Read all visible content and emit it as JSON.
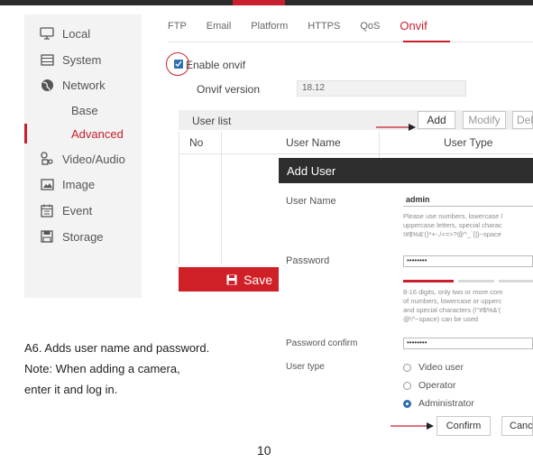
{
  "sidebar": {
    "items": [
      {
        "label": "Local",
        "icon": "monitor-icon"
      },
      {
        "label": "System",
        "icon": "window-icon"
      },
      {
        "label": "Network",
        "icon": "globe-icon"
      },
      {
        "label": "Base"
      },
      {
        "label": "Advanced",
        "active": true
      },
      {
        "label": "Video/Audio",
        "icon": "camera-icon"
      },
      {
        "label": "Image",
        "icon": "image-icon"
      },
      {
        "label": "Event",
        "icon": "calendar-icon"
      },
      {
        "label": "Storage",
        "icon": "floppy-disk-icon"
      }
    ]
  },
  "tabs": [
    "FTP",
    "Email",
    "Platform",
    "HTTPS",
    "QoS",
    "Onvif"
  ],
  "active_tab": "Onvif",
  "onvif": {
    "enable_label": "Enable onvif",
    "enabled": true,
    "version_label": "Onvif version",
    "version_value": "18.12"
  },
  "user_list": {
    "title": "User list",
    "buttons": {
      "add": "Add",
      "modify": "Modify",
      "delete": "Del"
    },
    "columns": [
      "No",
      "User Name",
      "User Type"
    ]
  },
  "save_label": "Save",
  "dialog": {
    "title": "Add User",
    "username_label": "User Name",
    "username_value": "admin",
    "username_hint": [
      "Please use numbers, lowercase l",
      "uppercase letters, special charac",
      "!#$%&'()*+-./<=>?@^_`{|}~space"
    ],
    "password_label": "Password",
    "password_value": "••••••••",
    "password_hint": [
      "8-16 digits, only two or more com",
      "of numbers, lowercase or upperc",
      "and special characters (!\"#$%&'(",
      "@\\^~space) can be used"
    ],
    "confirm_label": "Password confirm",
    "confirm_value": "••••••••",
    "usertype_label": "User type",
    "user_types": [
      {
        "label": "Video user",
        "selected": false
      },
      {
        "label": "Operator",
        "selected": false
      },
      {
        "label": "Administrator",
        "selected": true
      }
    ],
    "confirm_button": "Confirm",
    "cancel_button": "Canc"
  },
  "caption": {
    "line1": "A6.  Adds user name and password.",
    "line2": "Note: When adding a camera,",
    "line3": "enter it and log in."
  },
  "page_number": "10",
  "colors": {
    "accent": "#c8202e",
    "checkbox": "#2f6fb5",
    "dialog_header": "#2e2e2e"
  }
}
